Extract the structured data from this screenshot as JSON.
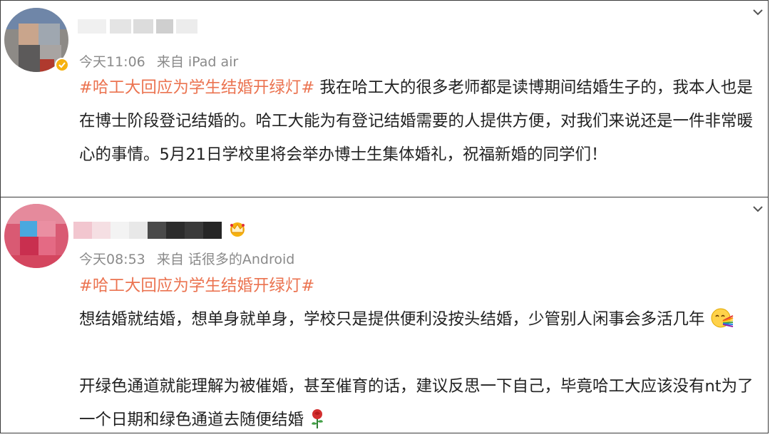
{
  "posts": [
    {
      "meta_time": "今天11:06",
      "meta_source": "来自 iPad air",
      "hashtag": "#哈工大回应为学生结婚开绿灯#",
      "body": " 我在哈工大的很多老师都是读博期间结婚生子的，我本人也是在博士阶段登记结婚的。哈工大能为有登记结婚需要的人提供方便，对我们来说还是一件非常暖心的事情。5月21日学校里将会举办博士生集体婚礼，祝福新婚的同学们！"
    },
    {
      "meta_time": "今天08:53",
      "meta_source": "来自 话很多的Android",
      "hashtag": "#哈工大回应为学生结婚开绿灯#",
      "paragraph1": "想结婚就结婚，想单身就单身，学校只是提供便利没按头结婚，少管别人闲事会多活几年",
      "paragraph2": "开绿色通道就能理解为被催婚，甚至催育的话，建议反思一下自己，毕竟哈工大应该没有nt为了一个日期和绿色通道去随便结婚"
    }
  ],
  "colors": {
    "hashtag": "#eb7350",
    "meta": "#8a8a8a",
    "text": "#222222",
    "border": "#3a3a3a"
  },
  "icons": [
    "chevron-down-icon",
    "verified-badge-icon",
    "crown-badge-icon",
    "rainbow-face-emoji",
    "rose-emoji"
  ]
}
